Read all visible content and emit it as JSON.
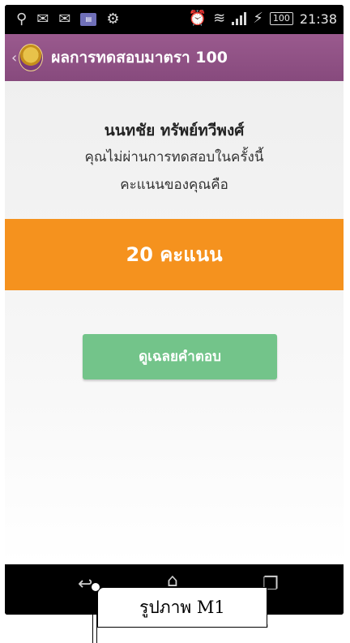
{
  "status_bar": {
    "icons": [
      "usb-icon",
      "gmail-icon",
      "gmail-icon",
      "message-icon",
      "android-icon",
      "alarm-icon",
      "wifi-icon",
      "signal-icon",
      "charging-icon"
    ],
    "battery": "100",
    "time": "21:38"
  },
  "action_bar": {
    "title": "ผลการทดสอบมาตรา 100"
  },
  "result": {
    "name": "นนทชัย ทรัพย์ทวีพงศ์",
    "message": "คุณไม่ผ่านการทดสอบในครั้งนี้",
    "score_prompt": "คะแนนของคุณคือ",
    "score_text": "20 คะแนน",
    "score_value": 20
  },
  "buttons": {
    "view_answers": "ดูเฉลยคำตอบ"
  },
  "caption": "รูปภาพ M1",
  "colors": {
    "action_bar": "#874a7d",
    "score_band": "#f5921e",
    "button": "#73c48a"
  }
}
